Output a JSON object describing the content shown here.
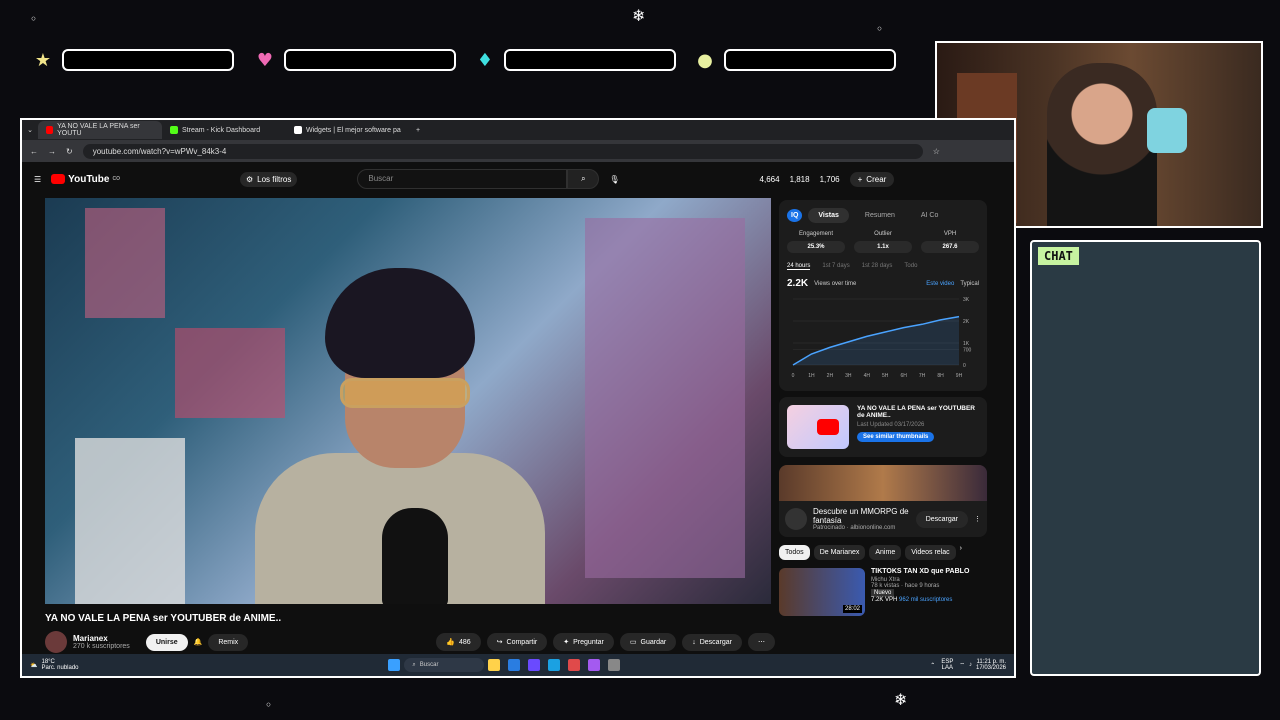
{
  "browser": {
    "tabs": [
      {
        "label": "YA NO VALE LA PENA ser YOUTU",
        "color": "#ff0000",
        "active": true
      },
      {
        "label": "Stream - Kick Dashboard",
        "color": "#53fc18",
        "active": false
      },
      {
        "label": "Widgets | El mejor software pa",
        "color": "#ffffff",
        "active": false
      }
    ],
    "url": "youtube.com/watch?v=wPWv_84k3-4"
  },
  "youtube": {
    "logo": "YouTube",
    "logo_sup": "CO",
    "filters": "Los filtros",
    "search_placeholder": "Buscar",
    "counts": [
      "4,664",
      "1,818",
      "1,706"
    ],
    "create": "Crear",
    "video_title": "YA NO VALE LA PENA ser YOUTUBER de ANIME..",
    "channel_name": "Marianex",
    "subscribers": "270 k suscriptores",
    "join": "Unirse",
    "remix": "Remix",
    "likes": "486",
    "share": "Compartir",
    "ask": "Preguntar",
    "save": "Guardar",
    "download": "Descargar"
  },
  "vidiq": {
    "badge": "IQ",
    "tabs": [
      "Vistas",
      "Resumen",
      "AI Co"
    ],
    "stats": [
      {
        "label": "Engagement",
        "value": "25.3%"
      },
      {
        "label": "Outlier",
        "value": "1.1x"
      },
      {
        "label": "VPH",
        "value": "267.6"
      }
    ],
    "ranges": [
      "24 hours",
      "1st 7 days",
      "1st 28 days",
      "Todo"
    ],
    "views_total": "2.2K",
    "views_label": "Views over time",
    "legend": [
      "Este video",
      "Typical"
    ],
    "thumb_title": "YA NO VALE LA PENA ser YOUTUBER de ANIME..",
    "updated": "Last Updated 03/17/2026",
    "similar_btn": "See similar thumbnails"
  },
  "chart_data": {
    "type": "area",
    "title": "",
    "xlabel": "",
    "ylabel": "",
    "x": [
      "0",
      "1H",
      "2H",
      "3H",
      "4H",
      "5H",
      "6H",
      "7H",
      "8H",
      "9H"
    ],
    "yticks": [
      "3K",
      "2K",
      "1K",
      "700",
      "0"
    ],
    "ylim": [
      0,
      3000
    ],
    "series": [
      {
        "name": "Este video",
        "values": [
          0,
          500,
          800,
          1050,
          1300,
          1500,
          1700,
          1850,
          2050,
          2200
        ]
      }
    ]
  },
  "ad": {
    "title": "Descubre un MMORPG de fantasía",
    "sponsor": "Patrocinado · albiononline.com",
    "button": "Descargar"
  },
  "chips": [
    "Todos",
    "De Marianex",
    "Anime",
    "Videos relac"
  ],
  "recommended": {
    "title": "TIKTOKS TAN XD que PABLO",
    "channel": "Michu Xtra",
    "meta": "78 k vistas · hace 9 horas",
    "badge": "Nuevo",
    "vph": "7.2K VPH",
    "subs": "962 mil suscriptores",
    "duration": "28:02"
  },
  "taskbar": {
    "temp": "18°C",
    "weather": "Parc. nublado",
    "search": "Buscar",
    "lang": "ESP",
    "lang2": "LAA",
    "time": "11:21 p. m.",
    "date": "17/03/2026"
  },
  "chat": {
    "label": "CHAT"
  },
  "bar_colors": [
    "#f2e58a",
    "#f06ab4",
    "#3fe0e0",
    "#e8f0a0"
  ]
}
